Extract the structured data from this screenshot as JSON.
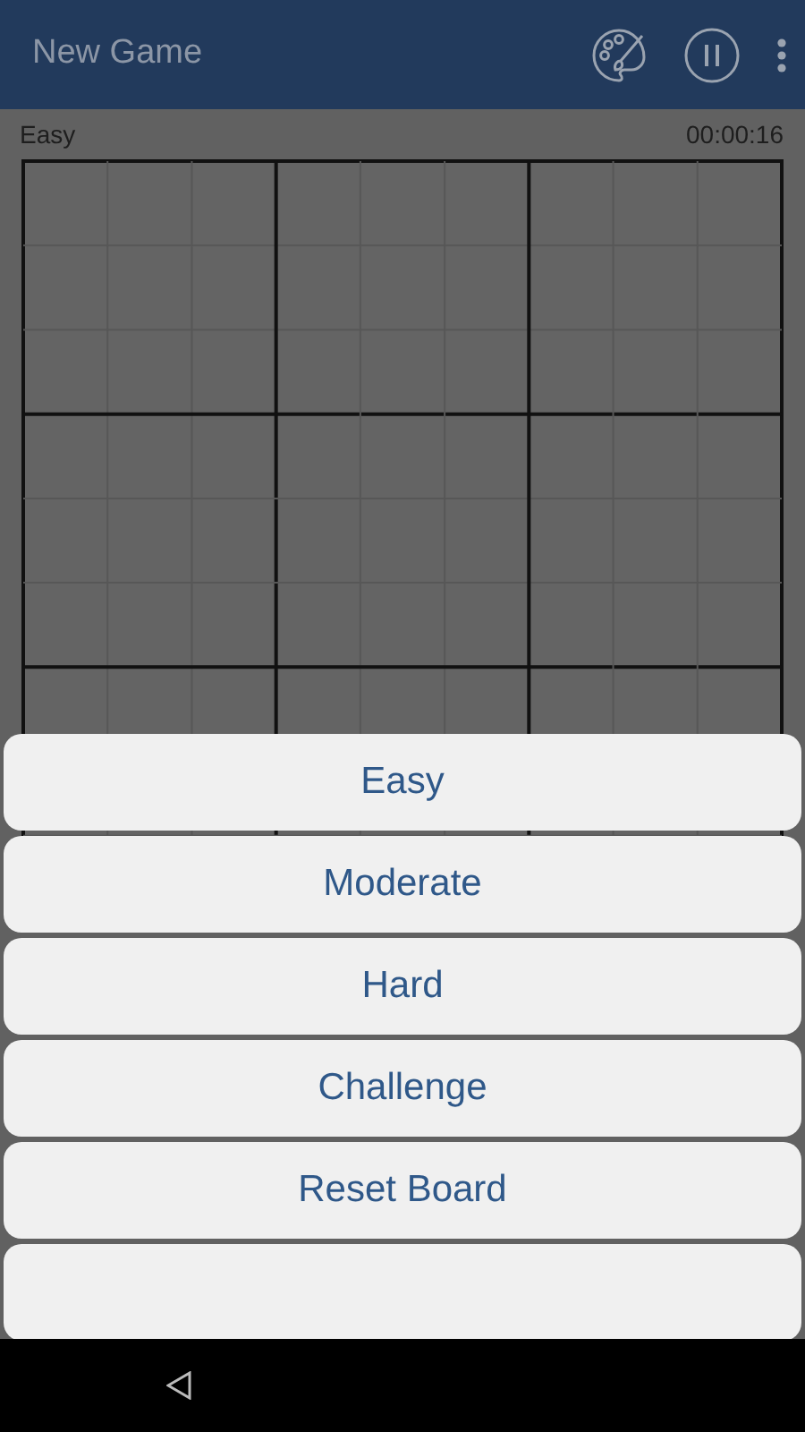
{
  "app_bar": {
    "title": "New Game"
  },
  "status": {
    "difficulty": "Easy",
    "timer": "00:00:16"
  },
  "menu": {
    "options": [
      {
        "label": "Easy"
      },
      {
        "label": "Moderate"
      },
      {
        "label": "Hard"
      },
      {
        "label": "Challenge"
      },
      {
        "label": "Reset Board"
      }
    ]
  }
}
